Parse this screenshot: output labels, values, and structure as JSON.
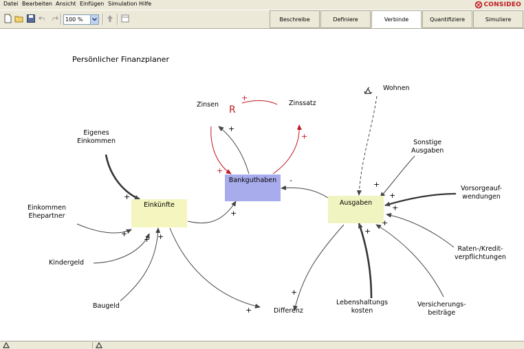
{
  "menu": [
    "Datei",
    "Bearbeiten",
    "Ansicht",
    "Einfügen",
    "Simulation",
    "Hilfe"
  ],
  "logo": {
    "text": "CONSIDEO"
  },
  "toolbar": {
    "zoom": "100 %"
  },
  "tabs": [
    {
      "label": "Beschreibe",
      "active": false
    },
    {
      "label": "Definiere",
      "active": false
    },
    {
      "label": "Verbinde",
      "active": true
    },
    {
      "label": "Quantifiziere",
      "active": false
    },
    {
      "label": "Simuliere",
      "active": false
    }
  ],
  "diagram": {
    "title": "Persönlicher Finanzplaner",
    "nodes": {
      "einkuenfte": "Einkünfte",
      "bankguthaben": "Bankguthaben",
      "ausgaben": "Ausgaben",
      "zinsen": "Zinsen",
      "zinssatz": "Zinssatz",
      "wohnen": "Wohnen",
      "eigenes_einkommen": "Eigenes\nEinkommen",
      "einkommen_ehepartner": "Einkommen\nEhepartner",
      "kindergeld": "Kindergeld",
      "baugeld": "Baugeld",
      "differenz": "Differenz",
      "sonstige_ausgaben": "Sonstige\nAusgaben",
      "vorsorge": "Vorsorgeauf-\nwendungen",
      "raten": "Raten-/Kredit-\nverpflichtungen",
      "versicherung": "Versicherungs-\nbeiträge",
      "lebenshaltung": "Lebenshaltungs\nkosten"
    },
    "loop_label": "R",
    "signs": {
      "plus": "+",
      "minus": "-"
    }
  },
  "colors": {
    "einkuenfte_fill": "#f5f5c0",
    "ausgaben_fill": "#f0f4c0",
    "bank_fill": "#a9acec",
    "loop_red": "#c0181f"
  }
}
